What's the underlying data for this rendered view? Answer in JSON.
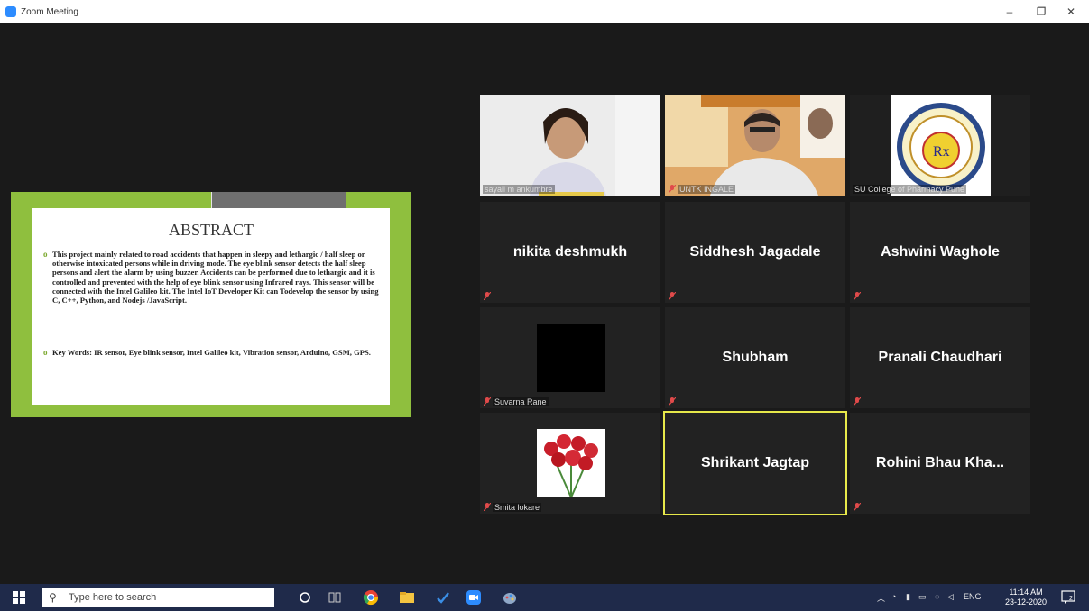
{
  "window": {
    "title": "Zoom Meeting",
    "minimize": "–",
    "restore": "❐",
    "close": "✕"
  },
  "slide": {
    "heading": "ABSTRACT",
    "paragraph1": "This project mainly related to road accidents that happen in sleepy and lethargic / half sleep or otherwise intoxicated persons while in driving mode. The eye blink sensor detects the half sleep persons and alert the alarm by using buzzer. Accidents can be performed due to lethargic and it is controlled and prevented with the help of eye blink sensor using Infrared rays. This sensor will be connected with the Intel Galileo kit. The Intel IoT Developer Kit can Todevelop the sensor by using C, C++, Python, and Nodejs /JavaScript.",
    "paragraph2": "Key Words: IR sensor, Eye blink sensor, Intel Galileo kit, Vibration sensor, Arduino, GSM, GPS.",
    "accent_color": "#8fbf3e"
  },
  "participants": [
    {
      "label": "sayali m ankumbre",
      "type": "video"
    },
    {
      "label": "UNTK INGALE",
      "type": "video"
    },
    {
      "label": "SU College of Pharmacy Pune",
      "type": "logo"
    },
    {
      "name": "nikita deshmukh",
      "type": "name"
    },
    {
      "name": "Siddhesh Jagadale",
      "type": "name"
    },
    {
      "name": "Ashwini Waghole",
      "type": "name"
    },
    {
      "label": "Suvarna Rane",
      "type": "black-image"
    },
    {
      "name": "Shubham",
      "type": "name"
    },
    {
      "name": "Pranali Chaudhari",
      "type": "name"
    },
    {
      "label": "Smita lokare",
      "type": "roses-image"
    },
    {
      "name": "Shrikant Jagtap",
      "type": "name",
      "active_speaker": true
    },
    {
      "name": "Rohini Bhau Kha...",
      "type": "name"
    }
  ],
  "taskbar": {
    "search_placeholder": "Type here to search",
    "language": "ENG",
    "time": "11:14 AM",
    "date": "23-12-2020",
    "notification_count": "2"
  },
  "colors": {
    "zoom_blue": "#2d8cff",
    "active_speaker": "#e6e84a",
    "muted_mic": "#e04a4a"
  }
}
